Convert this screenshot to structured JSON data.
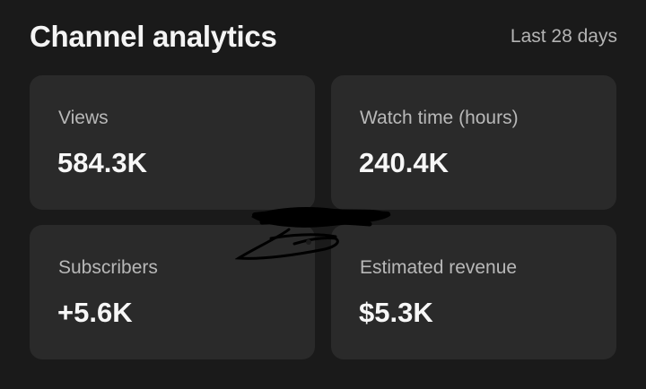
{
  "header": {
    "title": "Channel analytics",
    "period": "Last 28 days"
  },
  "metrics": [
    {
      "label": "Views",
      "value": "584.3K"
    },
    {
      "label": "Watch time (hours)",
      "value": "240.4K"
    },
    {
      "label": "Subscribers",
      "value": "+5.6K"
    },
    {
      "label": "Estimated revenue",
      "value": "$5.3K"
    }
  ],
  "colors": {
    "background": "#1a1a1a",
    "card": "#2a2a2a",
    "label": "#b8b8b8",
    "value": "#f7f7f7"
  }
}
